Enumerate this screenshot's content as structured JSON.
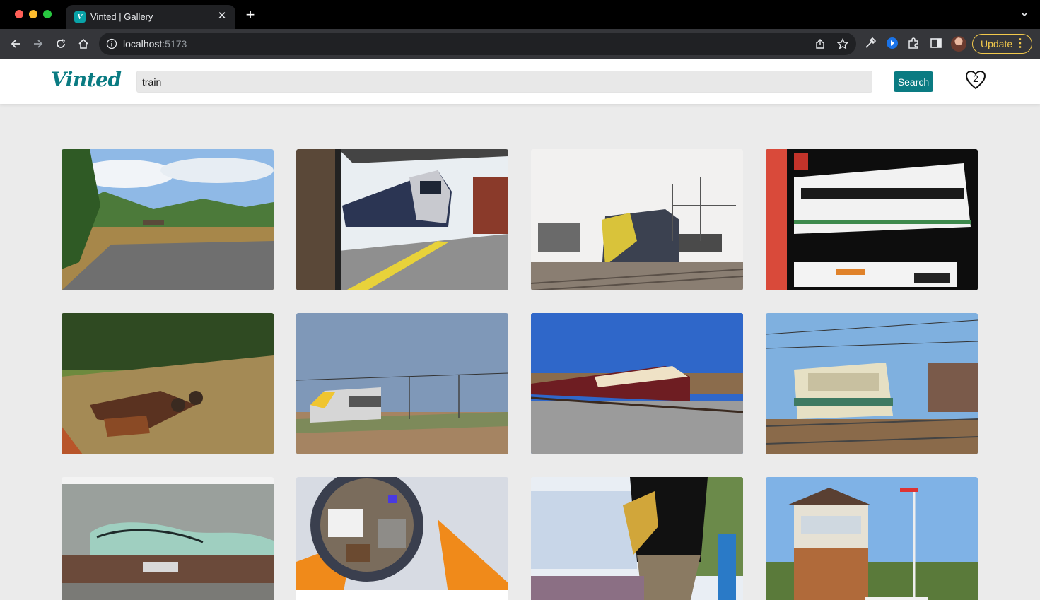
{
  "browser": {
    "tab_title": "Vinted | Gallery",
    "url_host": "localhost",
    "url_port": ":5173",
    "update_label": "Update"
  },
  "header": {
    "logo": "Vinted",
    "search_value": "train",
    "search_button": "Search",
    "favorites_count": "2"
  },
  "gallery": {
    "images": [
      {
        "subject": "mountain-road-landscape"
      },
      {
        "subject": "train-at-platform"
      },
      {
        "subject": "yellow-diesel-locomotive"
      },
      {
        "subject": "white-japanese-train"
      },
      {
        "subject": "rusty-bogies-in-forest"
      },
      {
        "subject": "white-electric-locomotive-in-field"
      },
      {
        "subject": "red-cream-locomotive"
      },
      {
        "subject": "green-cream-electric-locomotive"
      },
      {
        "subject": "graffiti-freight-wagon"
      },
      {
        "subject": "hotel-room-advert"
      },
      {
        "subject": "saxophone-street-performer"
      },
      {
        "subject": "signal-box"
      }
    ]
  }
}
